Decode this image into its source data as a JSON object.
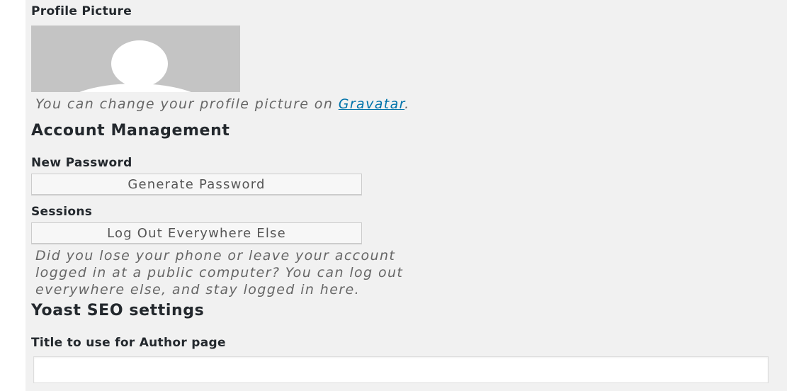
{
  "profile_picture": {
    "label": "Profile Picture",
    "caption_prefix": "You can change your profile picture on ",
    "gravatar_link": "Gravatar",
    "caption_suffix": "."
  },
  "account_management": {
    "heading": "Account Management",
    "new_password_label": "New Password",
    "generate_password_button": "Generate Password",
    "sessions_label": "Sessions",
    "logout_everywhere_button": "Log Out Everywhere Else",
    "sessions_description_line1": "Did you lose your phone or leave your account",
    "sessions_description_line2": "logged in at a public computer? You can log out",
    "sessions_description_line3": "everywhere else, and stay logged in here."
  },
  "yoast": {
    "heading": "Yoast SEO settings",
    "author_title_label": "Title to use for Author page",
    "author_title_value": ""
  },
  "colors": {
    "panel_background": "#f1f1f1",
    "link": "#0073aa",
    "avatar_background": "#c4c4c4"
  }
}
